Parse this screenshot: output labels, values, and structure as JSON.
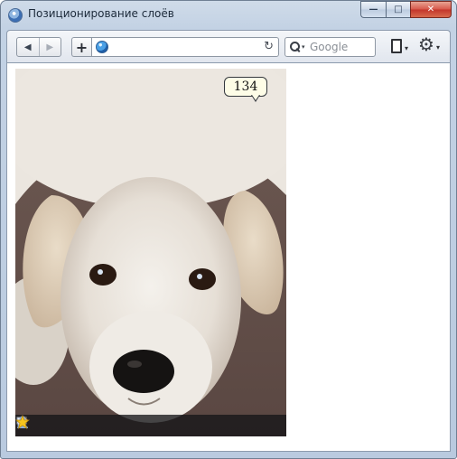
{
  "window": {
    "title": "Позиционирование слоёв",
    "buttons": {
      "minimize": "—",
      "maximize": "□",
      "close": "✕"
    }
  },
  "toolbar": {
    "back_glyph": "◀",
    "forward_glyph": "▶",
    "add_glyph": "+",
    "url_value": "",
    "reload_glyph": "↻",
    "search_placeholder": "Google",
    "menu_caret": "▾",
    "gear_glyph": "⚙"
  },
  "page": {
    "badge_count": "134",
    "photo_subject": "puppy",
    "bar_icons": [
      "comment-icon",
      "user-icon",
      "star-icon"
    ]
  },
  "colors": {
    "close_button": "#c2352a",
    "badge_background": "#fefde7",
    "star": "#f6c51e",
    "user": "#8fb2de"
  }
}
